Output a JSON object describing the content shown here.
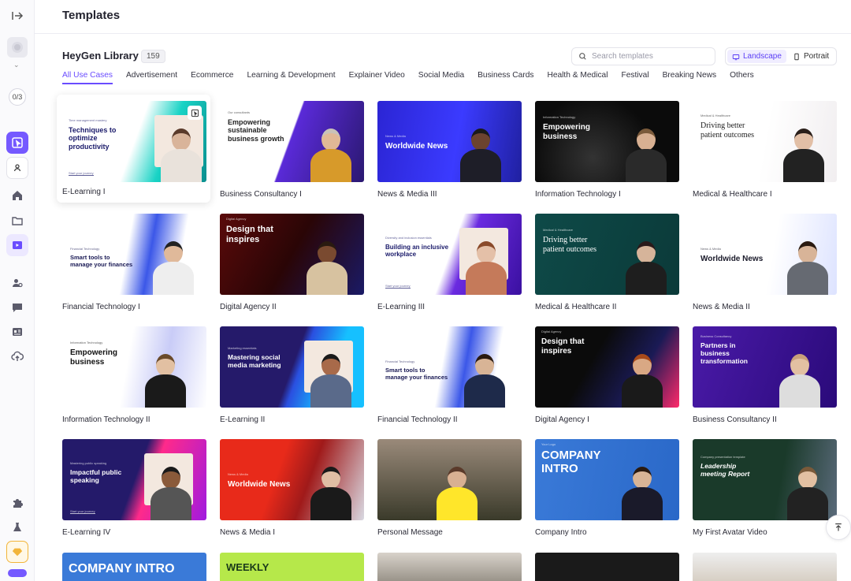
{
  "header": {
    "title": "Templates"
  },
  "sidebar": {
    "counter": "0/3"
  },
  "library": {
    "title": "HeyGen Library",
    "count": "159",
    "search_placeholder": "Search templates",
    "orientation": {
      "landscape": "Landscape",
      "portrait": "Portrait",
      "selected": "Landscape"
    }
  },
  "tabs": [
    {
      "label": "All Use Cases"
    },
    {
      "label": "Advertisement"
    },
    {
      "label": "Ecommerce"
    },
    {
      "label": "Learning & Development"
    },
    {
      "label": "Explainer Video"
    },
    {
      "label": "Social Media"
    },
    {
      "label": "Business Cards"
    },
    {
      "label": "Health & Medical"
    },
    {
      "label": "Festival"
    },
    {
      "label": "Breaking News"
    },
    {
      "label": "Others"
    }
  ],
  "templates": [
    {
      "label": "E-Learning I",
      "headline": "Techniques to optimize productivity",
      "kicker": "Time management mastery",
      "footer": "Start your journey"
    },
    {
      "label": "Business Consultancy I",
      "headline": "Empowering sustainable business growth",
      "kicker": "Our consultants"
    },
    {
      "label": "News & Media III",
      "headline": "Worldwide News",
      "kicker": "News & Media"
    },
    {
      "label": "Information Technology I",
      "headline": "Empowering business",
      "kicker": "Information Technology"
    },
    {
      "label": "Medical & Healthcare I",
      "headline": "Driving better patient outcomes",
      "kicker": "Medical & Healthcare"
    },
    {
      "label": "Financial Technology I",
      "headline": "Smart tools to manage your finances",
      "kicker": "Financial Technology"
    },
    {
      "label": "Digital Agency II",
      "headline": "Design that inspires",
      "kicker": "Digital Agency"
    },
    {
      "label": "E-Learning III",
      "headline": "Building an inclusive workplace",
      "kicker": "Diversity and inclusion essentials",
      "footer": "Start your journey"
    },
    {
      "label": "Medical & Healthcare II",
      "headline": "Driving better patient outcomes",
      "kicker": "Medical & Healthcare"
    },
    {
      "label": "News & Media II",
      "headline": "Worldwide News",
      "kicker": "News & Media"
    },
    {
      "label": "Information Technology II",
      "headline": "Empowering business",
      "kicker": "Information Technology"
    },
    {
      "label": "E-Learning II",
      "headline": "Mastering social media marketing",
      "kicker": "Marketing essentials"
    },
    {
      "label": "Financial Technology II",
      "headline": "Smart tools to manage your finances",
      "kicker": "Financial Technology"
    },
    {
      "label": "Digital Agency I",
      "headline": "Design that inspires",
      "kicker": "Digital Agency"
    },
    {
      "label": "Business Consultancy II",
      "headline": "Partners in business transformation",
      "kicker": "Business Consultancy"
    },
    {
      "label": "E-Learning IV",
      "headline": "Impactful public speaking",
      "kicker": "Mastering public speaking",
      "footer": "Start your journey"
    },
    {
      "label": "News & Media I",
      "headline": "Worldwide News",
      "kicker": "News & Media"
    },
    {
      "label": "Personal Message",
      "headline": ""
    },
    {
      "label": "Company Intro",
      "headline": "COMPANY INTRO",
      "kicker": "Your Logo"
    },
    {
      "label": "My First Avatar Video",
      "headline": "Leadership meeting Report",
      "kicker": "Company presentation template"
    }
  ],
  "partial_row": [
    {
      "headline": "COMPANY INTRO"
    },
    {
      "headline": "WEEKLY"
    },
    {
      "headline": ""
    },
    {
      "headline": ""
    },
    {
      "headline": ""
    }
  ],
  "colors": {
    "accent": "#6a4cff",
    "sidebar_active": "#7559ff",
    "gem": "#f2b53a"
  }
}
